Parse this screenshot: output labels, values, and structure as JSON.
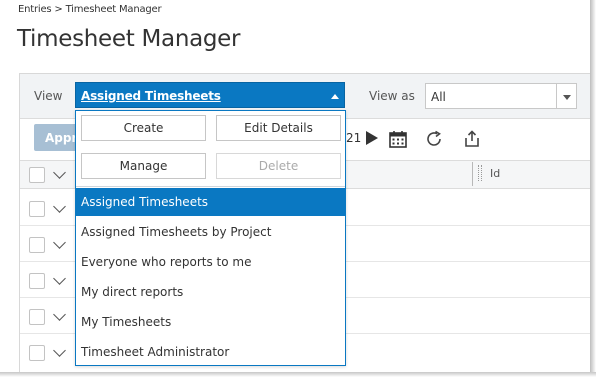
{
  "breadcrumb": "Entries > Timesheet Manager",
  "page_title": "Timesheet Manager",
  "view_bar": {
    "view_label": "View",
    "view_value": "Assigned Timesheets",
    "view_as_label": "View as",
    "view_as_value": "All"
  },
  "toolbar": {
    "approve_label": "Appro",
    "date_partial": "21"
  },
  "grid": {
    "id_column_label": "Id"
  },
  "dropdown": {
    "buttons": {
      "create": "Create",
      "edit_details": "Edit Details",
      "manage": "Manage",
      "delete": "Delete"
    },
    "items": [
      "Assigned Timesheets",
      "Assigned Timesheets by Project",
      "Everyone who reports to me",
      "My direct reports",
      "My Timesheets",
      "Timesheet Administrator"
    ],
    "selected_item": "Assigned Timesheets"
  },
  "colors": {
    "accent": "#0a78c2",
    "approve_disabled": "#a7bfd4"
  }
}
